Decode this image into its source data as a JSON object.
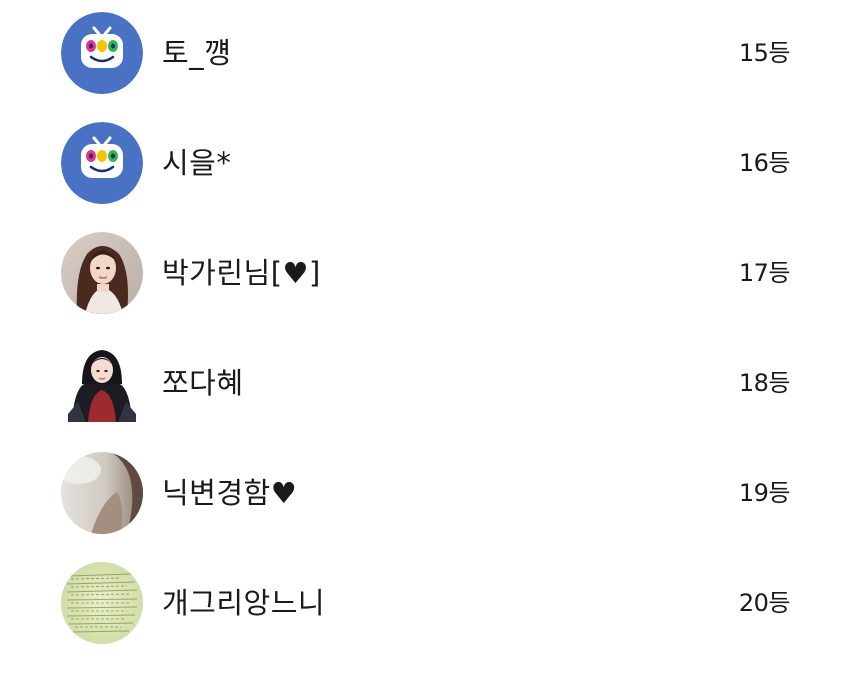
{
  "rows": [
    {
      "nickname": "토_꺵",
      "rank": "15등",
      "avatar": "tv-mascot-icon"
    },
    {
      "nickname": "시을*",
      "rank": "16등",
      "avatar": "tv-mascot-icon"
    },
    {
      "nickname": "박가린님[♥]",
      "rank": "17등",
      "avatar": "profile-photo"
    },
    {
      "nickname": "쪼다혜",
      "rank": "18등",
      "avatar": "profile-photo"
    },
    {
      "nickname": "닉변경함♥",
      "rank": "19등",
      "avatar": "profile-photo"
    },
    {
      "nickname": "개그리앙느니",
      "rank": "20등",
      "avatar": "profile-photo"
    }
  ],
  "colors": {
    "mascot_bg": "#4a72c4",
    "text": "#1a1a1a",
    "background": "#ffffff"
  }
}
